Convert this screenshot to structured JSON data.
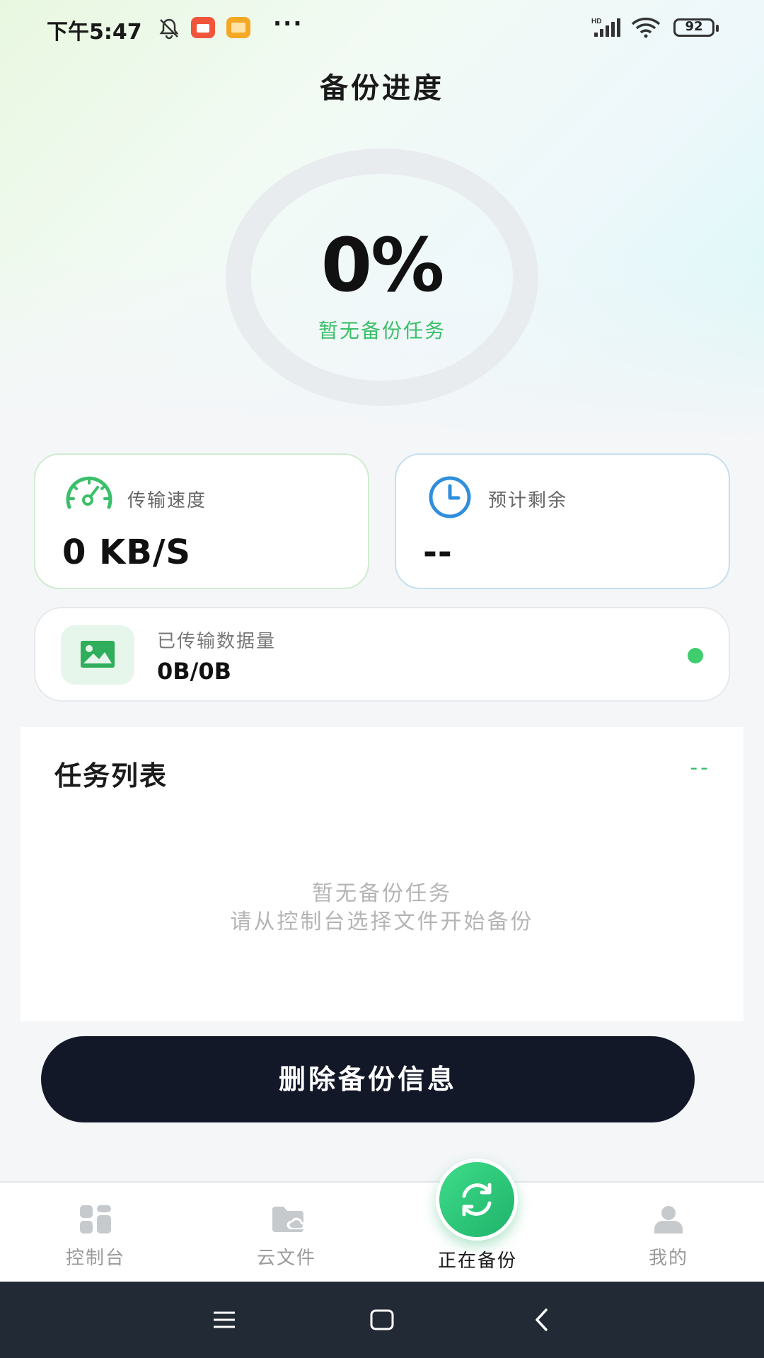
{
  "status_bar": {
    "time": "下午5:47",
    "icons": [
      "mute-bell-icon",
      "app-notification-icon",
      "gallery-notification-icon",
      "more-dots-icon",
      "hd-signal-icon",
      "wifi-icon",
      "battery-icon"
    ],
    "more": "···",
    "battery": "92"
  },
  "page": {
    "title": "备份进度"
  },
  "progress": {
    "percent_text": "0%",
    "value": 0,
    "status": "暂无备份任务",
    "ring_color": "#e9ecef"
  },
  "stats": {
    "speed": {
      "label": "传输速度",
      "value": "0 KB/S",
      "icon": "speedometer-icon"
    },
    "remaining": {
      "label": "预计剩余",
      "value": "--",
      "icon": "clock-icon"
    },
    "transferred": {
      "label": "已传输数据量",
      "value": "0B/0B",
      "icon": "image-icon",
      "dot_color": "#3fcd6e"
    }
  },
  "task_list": {
    "title": "任务列表",
    "count": "--",
    "empty_line1": "暂无备份任务",
    "empty_line2": "请从控制台选择文件开始备份"
  },
  "actions": {
    "delete_label": "删除备份信息"
  },
  "tabs": [
    {
      "label": "控制台",
      "icon": "dashboard-icon",
      "active": false
    },
    {
      "label": "云文件",
      "icon": "cloud-folder-icon",
      "active": false
    },
    {
      "label": "正在备份",
      "icon": "sync-icon",
      "active": true
    },
    {
      "label": "我的",
      "icon": "profile-icon",
      "active": false
    }
  ],
  "colors": {
    "accent": "#3bbf6a",
    "button_dark": "#131828",
    "nav_bar": "#222a35"
  }
}
